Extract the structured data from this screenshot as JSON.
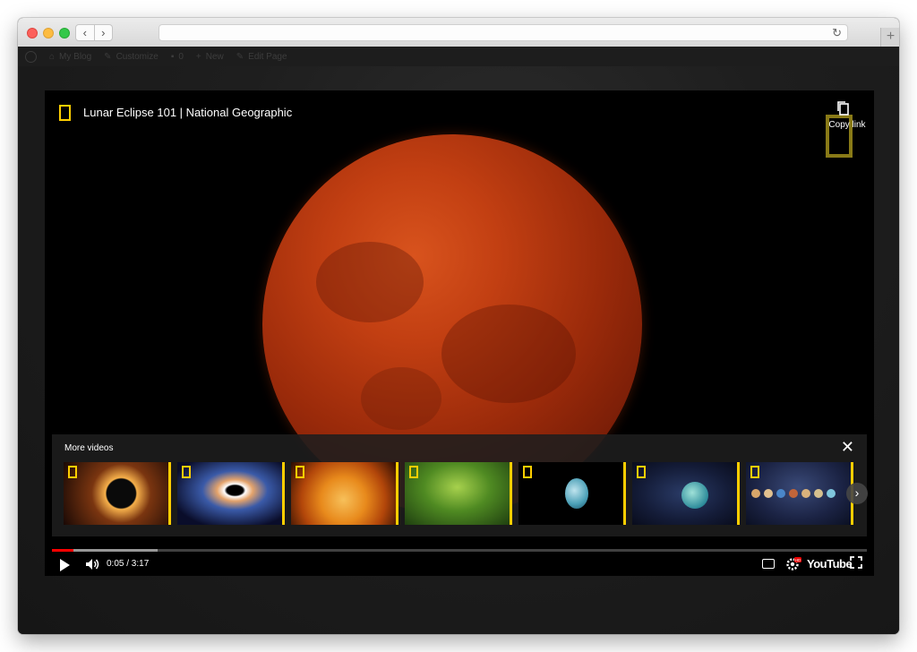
{
  "browser": {
    "back_icon": "‹",
    "forward_icon": "›",
    "reload_icon": "↻",
    "new_tab_icon": "+"
  },
  "wp_bar": {
    "items": [
      {
        "icon": "home-icon",
        "label": "My Blog"
      },
      {
        "icon": "brush-icon",
        "label": "Customize"
      },
      {
        "icon": "comment-icon",
        "label": "0"
      },
      {
        "icon": "plus-icon",
        "label": "New"
      },
      {
        "icon": "pencil-icon",
        "label": "Edit Page"
      }
    ]
  },
  "player": {
    "title": "Lunar Eclipse 101 | National Geographic",
    "copy_link_label": "Copy link",
    "more_videos_label": "More videos",
    "close_icon": "✕",
    "next_icon": "›",
    "time": "0:05 / 3:17",
    "progress_played": 0.026,
    "progress_loaded": 0.13,
    "youtube_label": "YouTube",
    "hd_badge": "HD",
    "accent_color": "#ffce00",
    "progress_color": "#ff0000"
  },
  "thumbnails": [
    {
      "icon": "ng-logo-icon",
      "subject": "solar eclipse"
    },
    {
      "icon": "ng-logo-icon",
      "subject": "black hole"
    },
    {
      "icon": "ng-logo-icon",
      "subject": "sun"
    },
    {
      "icon": "ng-logo-icon",
      "subject": "insect"
    },
    {
      "icon": "ng-logo-icon",
      "subject": "uranus"
    },
    {
      "icon": "ng-logo-icon",
      "subject": "exoplanet"
    },
    {
      "icon": "ng-logo-icon",
      "subject": "solar system"
    }
  ]
}
